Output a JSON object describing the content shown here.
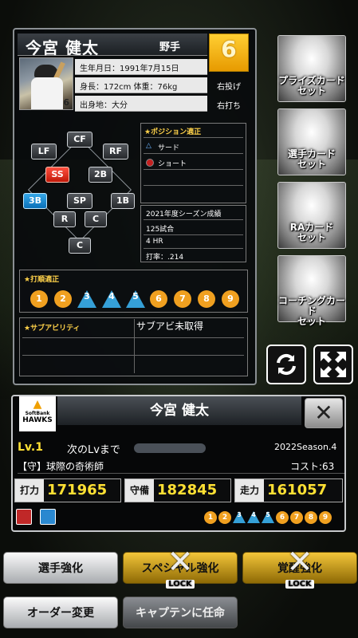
{
  "player": {
    "name": "今宮 健太",
    "type": "野手",
    "number": "6",
    "photo_number": "6",
    "birth": "生年月日：1991年7月15日",
    "body": "身長：172cm 体重：76kg",
    "birthplace": "出身地：大分",
    "throw": "右投げ",
    "bat": "右打ち"
  },
  "positions": {
    "LF": "LF",
    "CF": "CF",
    "RF": "RF",
    "SS": "SS",
    "2B": "2B",
    "3B": "3B",
    "SP": "SP",
    "1B": "1B",
    "R": "R",
    "C1": "C",
    "C2": "C"
  },
  "position_panel": {
    "title": "★ポジション適正",
    "items": [
      "サード",
      "ショート"
    ]
  },
  "season": {
    "title": "2021年度シーズン成績",
    "games": "125試合",
    "hr": "4 HR",
    "avg": "打率：.214"
  },
  "batting_order": {
    "title": "★打順適正",
    "items": [
      "1",
      "2",
      "3",
      "4",
      "5",
      "6",
      "7",
      "8",
      "9"
    ],
    "triangle": [
      3,
      4,
      5
    ]
  },
  "sub_ability": {
    "title": "★サブアビリティ",
    "status": "サブアビ未取得"
  },
  "side_buttons": [
    "プライズカード\nセット",
    "選手カード\nセット",
    "RAカード\nセット",
    "コーチングカード\nセット"
  ],
  "icons": {
    "refresh": "refresh-icon",
    "expand": "expand-icon"
  },
  "detail": {
    "team_logo_top": "SoftBank",
    "team_logo": "HAWKS",
    "name": "今宮 健太",
    "close": "✕",
    "level": "Lv.1",
    "next_level": "次のLvまで",
    "season": "2022Season.4",
    "skill": "【守】球際の奇術師",
    "cost": "コスト:63",
    "stats": [
      {
        "label": "打力",
        "value": "171965"
      },
      {
        "label": "守備",
        "value": "182845"
      },
      {
        "label": "走力",
        "value": "161057"
      }
    ]
  },
  "actions": {
    "enhance": "選手強化",
    "special": "スペシャル強化",
    "awaken": "覚醒強化",
    "lock": "LOCK",
    "order": "オーダー変更",
    "captain": "キャプテンに任命"
  }
}
